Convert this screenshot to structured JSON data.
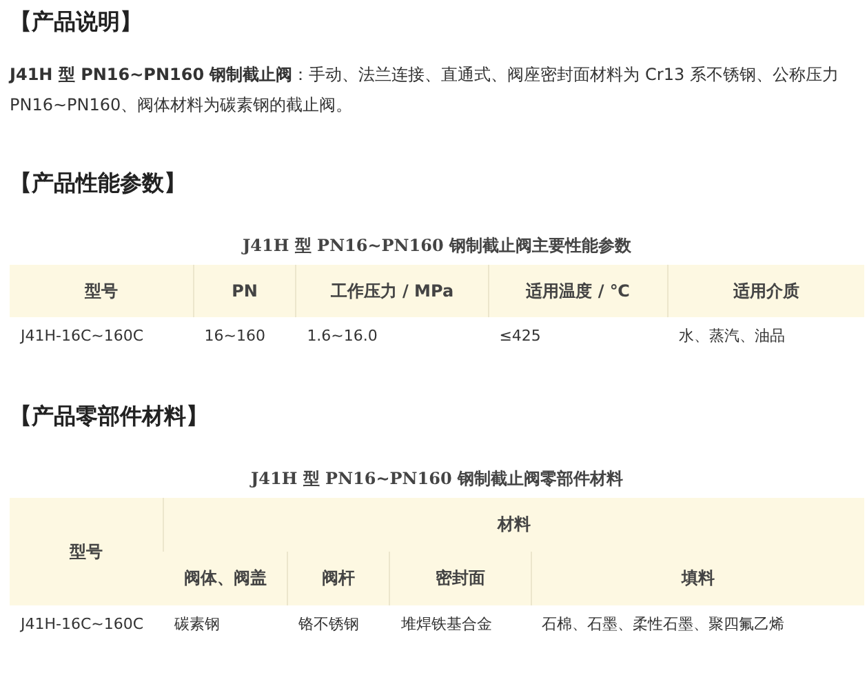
{
  "sections": [
    {
      "heading": "【产品说明】",
      "description": "**J41H 型 PN16~PN160 钢制截止阀**：手动、法兰连接、直通式、阀座密封面材料为 Cr13 系不锈钢、公称压力 PN16~PN160、阀体材料为碳素钢的截止阀。"
    },
    {
      "heading": "【产品性能参数】",
      "table": {
        "caption": "J41H 型 PN16~PN160 钢制截止阀主要性能参数",
        "columns": [
          "型号",
          "PN",
          "工作压力 / MPa",
          "适用温度 / ℃",
          "适用介质"
        ],
        "rows": [
          [
            "J41H-16C~160C",
            "16~160",
            "1.6~16.0",
            "≤425",
            "水、蒸汽、油品"
          ]
        ]
      }
    },
    {
      "heading": "【产品零部件材料】",
      "table": {
        "caption": "J41H 型 PN16~PN160 钢制截止阀零部件材料",
        "columns": [
          "型号"
        ],
        "group_header": "材料",
        "subcolumns": [
          "阀体、阀盖",
          "阀杆",
          "密封面",
          "填料"
        ],
        "rows": [
          [
            "J41H-16C~160C",
            "碳素钢",
            "铬不锈钢",
            "堆焊铁基合金",
            "石棉、石墨、柔性石墨、聚四氟乙烯"
          ]
        ]
      }
    }
  ]
}
